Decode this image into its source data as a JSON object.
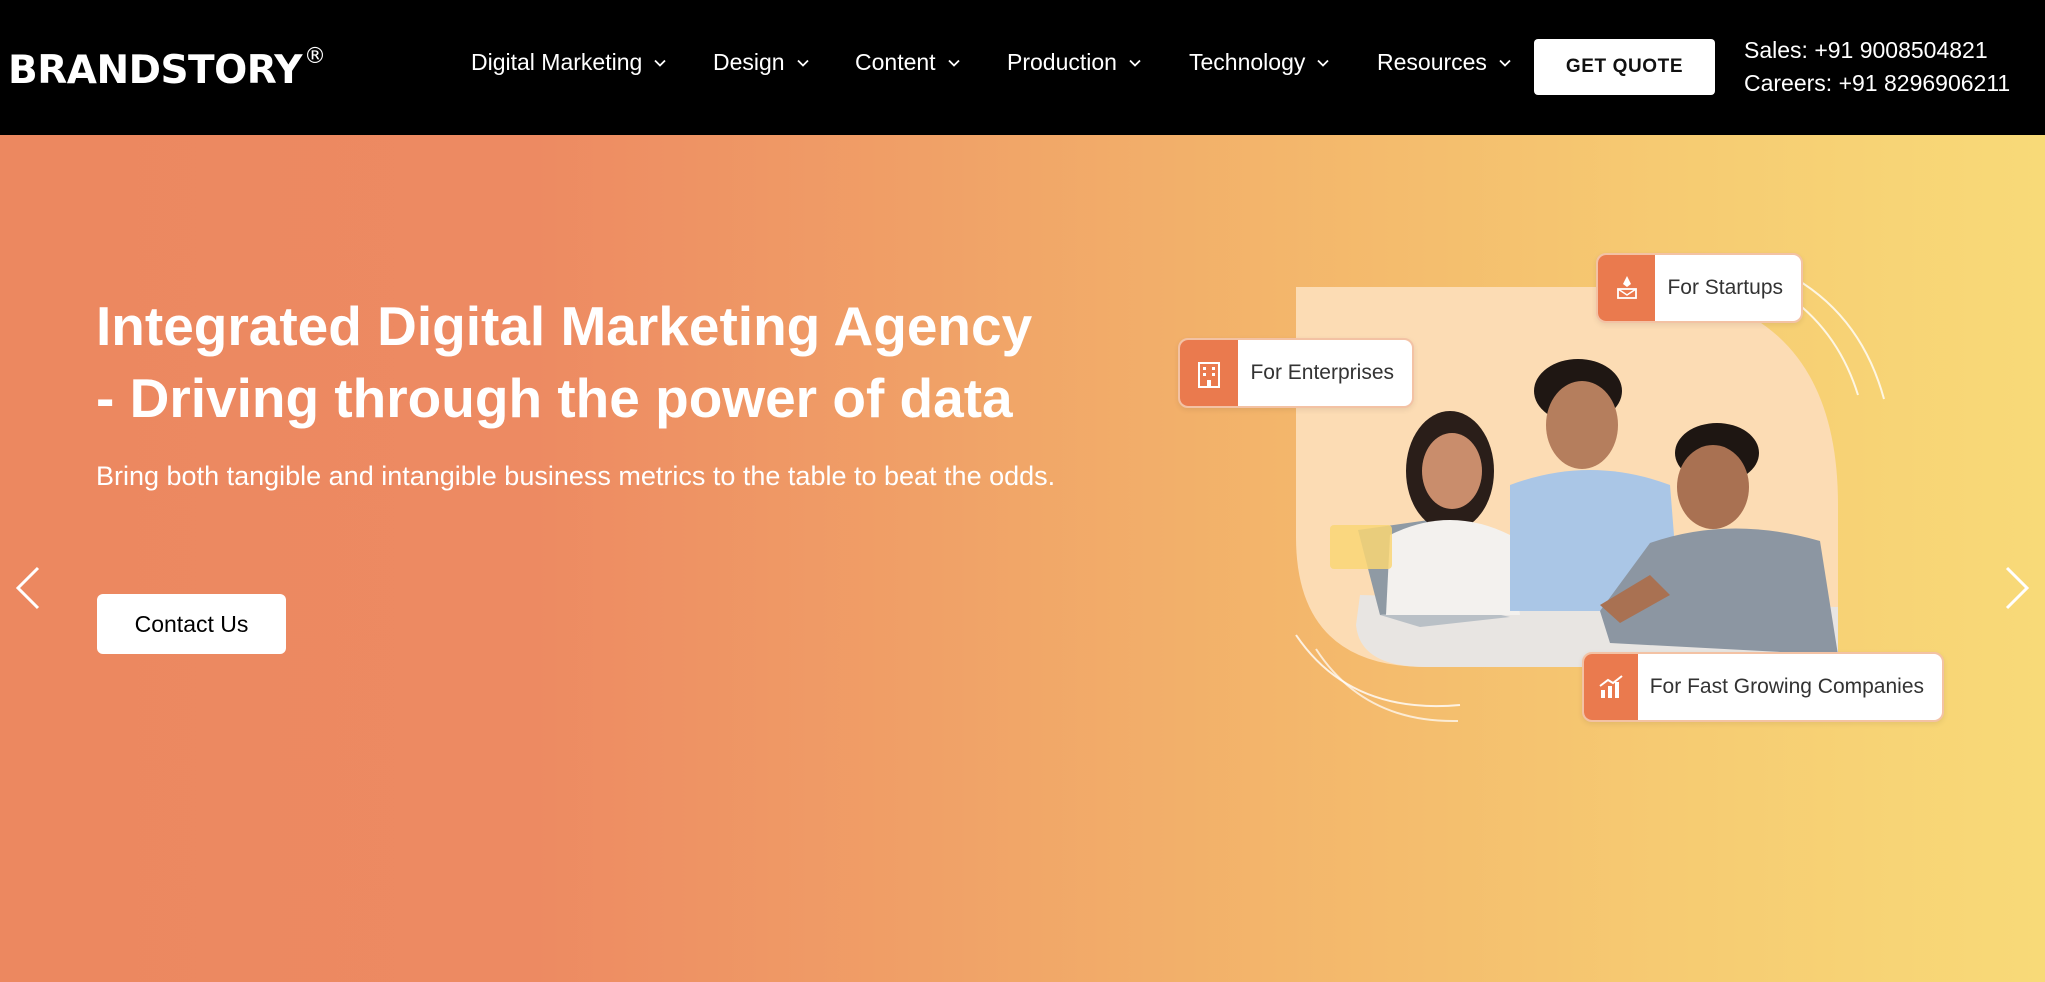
{
  "header": {
    "logo_text": "BRANDSTORY",
    "logo_mark": "®",
    "nav": [
      {
        "label": "Digital Marketing"
      },
      {
        "label": "Design"
      },
      {
        "label": "Content"
      },
      {
        "label": "Production"
      },
      {
        "label": "Technology"
      },
      {
        "label": "Resources"
      }
    ],
    "quote_button": "GET QUOTE",
    "sales": "Sales: +91 9008504821",
    "careers": "Careers: +91 8296906211"
  },
  "hero": {
    "title_line1": "Integrated Digital Marketing Agency",
    "title_line2": "- Driving through the power of data",
    "subtitle": "Bring both tangible and intangible business metrics to the table to beat the odds.",
    "cta": "Contact Us",
    "badges": {
      "startups": "For Startups",
      "enterprises": "For Enterprises",
      "fast_growing": "For Fast Growing Companies"
    }
  },
  "colors": {
    "header_bg": "#000000",
    "hero_gradient_start": "#ec8860",
    "hero_gradient_end": "#f8da78",
    "badge_accent": "#ea7a4e"
  },
  "icons": [
    "chevron-down-icon",
    "arrow-left-icon",
    "arrow-right-icon",
    "startup-icon",
    "building-icon",
    "growth-chart-icon"
  ]
}
